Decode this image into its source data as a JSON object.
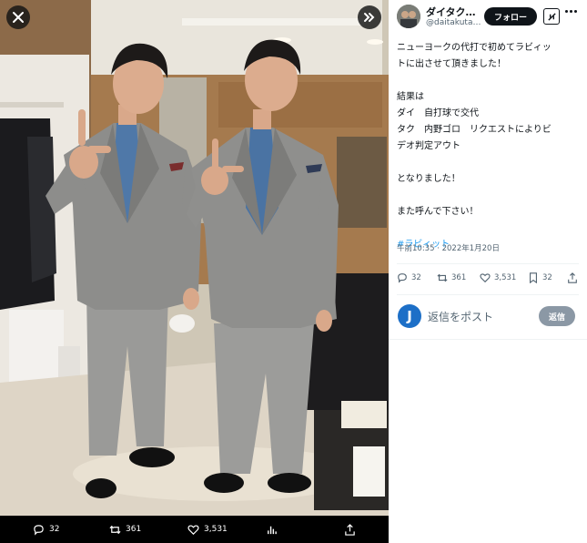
{
  "photo": {
    "close_icon": "close-icon",
    "expand_icon": "chevron-double-right-icon",
    "bar": {
      "replies": "32",
      "reposts": "361",
      "likes": "3,531"
    }
  },
  "tweet": {
    "display_name": "ダイタク…",
    "handle": "@daitakuta…",
    "follow_label": "フォロー",
    "lines": [
      "ニューヨークの代打で初めてラビィッ",
      "トに出させて頂きました！",
      "",
      "結果は",
      "ダイ　自打球で交代",
      "タク　内野ゴロ　リクエストによりビ",
      "デオ判定アウト",
      "",
      "となりました！",
      "",
      "また呼んで下さい！",
      ""
    ],
    "hashtag": "#ラビィット",
    "timestamp": "午前10:35 · 2022年1月20日",
    "stats": {
      "replies": "32",
      "reposts": "361",
      "likes": "3,531",
      "bookmarks": "32"
    },
    "reply_placeholder": "返信をポスト",
    "reply_button": "返信",
    "reply_avatar_letter": "J"
  },
  "colors": {
    "accent": "#1d9bf0",
    "text": "#0f1419",
    "muted": "#536471",
    "reply_avatar": "#1d6fc7"
  }
}
